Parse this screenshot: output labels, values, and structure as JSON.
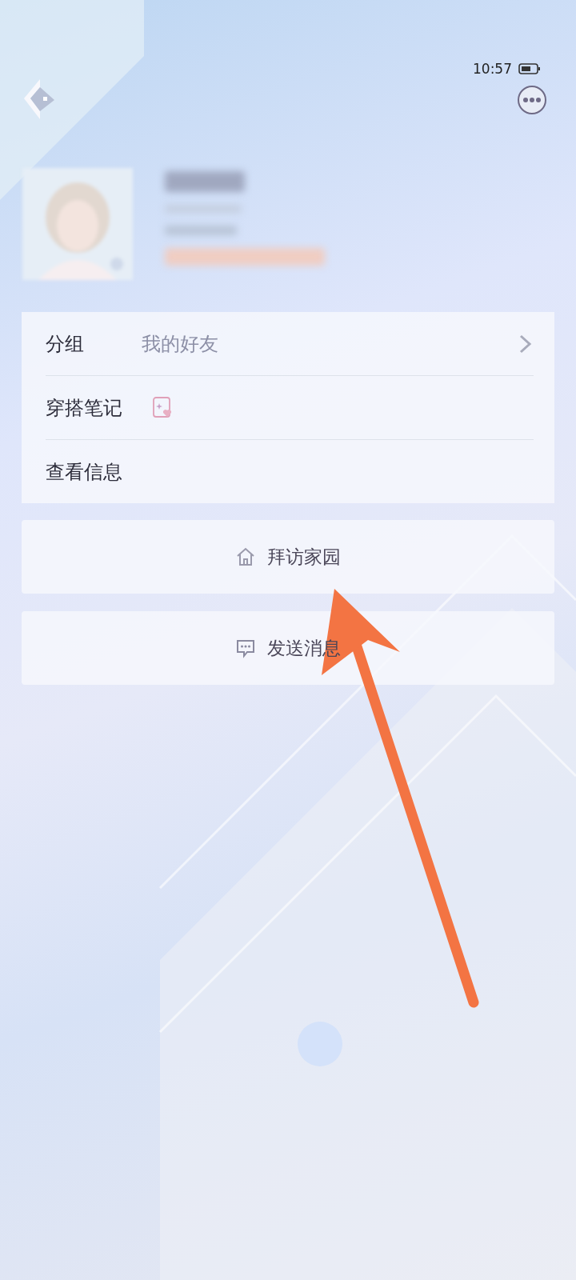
{
  "status_bar": {
    "time": "10:57"
  },
  "info_rows": [
    {
      "kind": "value",
      "label": "分组",
      "value": "我的好友"
    },
    {
      "kind": "icon",
      "label": "穿搭笔记"
    },
    {
      "kind": "plain",
      "label": "查看信息"
    }
  ],
  "actions": [
    {
      "kind": "home",
      "label": "拜访家园"
    },
    {
      "kind": "message",
      "label": "发送消息"
    }
  ]
}
